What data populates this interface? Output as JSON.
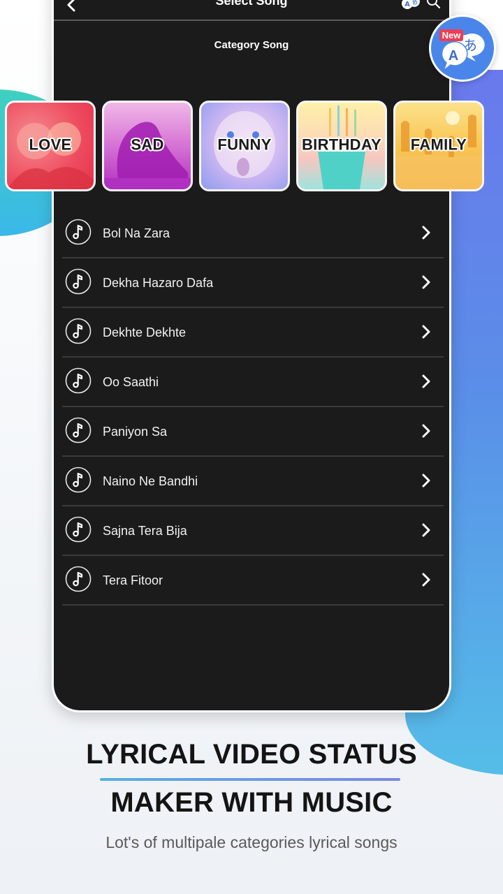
{
  "app_bar": {
    "title": "Select Song",
    "back_icon": "chevron-left-icon",
    "translate_icon": "translate-icon",
    "translate_badge": "New",
    "search_icon": "search-icon"
  },
  "subtitle": "Category Song",
  "categories": [
    {
      "label": "LOVE"
    },
    {
      "label": "SAD"
    },
    {
      "label": "FUNNY"
    },
    {
      "label": "BIRTHDAY"
    },
    {
      "label": "FAMILY"
    }
  ],
  "songs": [
    {
      "title": "Bol Na  Zara"
    },
    {
      "title": "Dekha Hazaro Dafa"
    },
    {
      "title": "Dekhte Dekhte"
    },
    {
      "title": "Oo Saathi"
    },
    {
      "title": "Paniyon Sa"
    },
    {
      "title": "Naino Ne Bandhi"
    },
    {
      "title": "Sajna Tera Bija"
    },
    {
      "title": "Tera Fitoor"
    }
  ],
  "translate_bubble": {
    "badge": "New",
    "latin_glyph": "A",
    "japanese_glyph": "あ"
  },
  "promo": {
    "headline_line1": "LYRICAL VIDEO STATUS",
    "headline_line2": "MAKER WITH MUSIC",
    "tagline": "Lot's of multipale categories lyrical songs"
  },
  "colors": {
    "phone_bg": "#1b1b1b",
    "accent_blue": "#4a86ea",
    "badge_red": "#ee3e54",
    "divider_start": "#58aee4",
    "divider_end": "#7a86e8"
  }
}
